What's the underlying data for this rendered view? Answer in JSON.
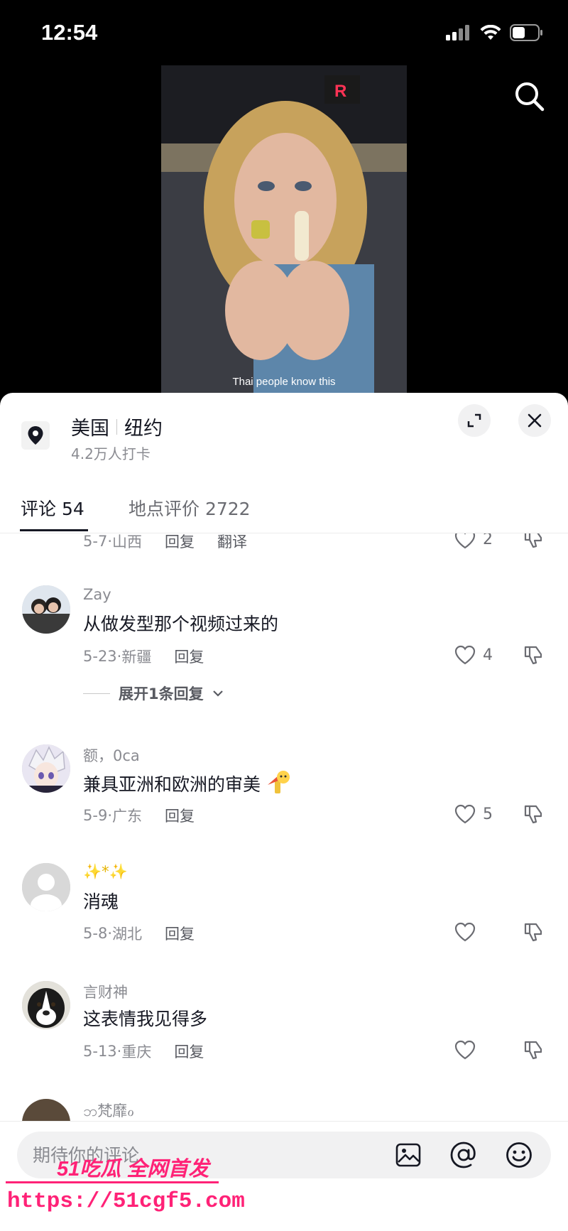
{
  "status_bar": {
    "time": "12:54",
    "icons": [
      "signal-icon",
      "wifi-icon",
      "battery-icon"
    ]
  },
  "video": {
    "caption": "Thai people know this"
  },
  "location": {
    "country": "美国",
    "city": "纽约",
    "checkins": "4.2万人打卡"
  },
  "tabs": [
    {
      "label": "评论 54",
      "active": true
    },
    {
      "label": "地点评价 2722",
      "active": false
    }
  ],
  "comments": [
    {
      "user": "",
      "text": "",
      "date": "5-7",
      "region": "山西",
      "reply": "回复",
      "translate": "翻译",
      "likes": "2",
      "partial": true
    },
    {
      "user": "Zay",
      "text": "从做发型那个视频过来的",
      "date": "5-23",
      "region": "新疆",
      "reply": "回复",
      "likes": "4",
      "expand": "展开1条回复"
    },
    {
      "user": "额，0ca",
      "text": "兼具亚洲和欧洲的审美",
      "date": "5-9",
      "region": "广东",
      "reply": "回复",
      "likes": "5"
    },
    {
      "user": "✨*✨",
      "text": "消魂",
      "date": "5-8",
      "region": "湖北",
      "reply": "回复",
      "likes": ""
    },
    {
      "user": "言财神",
      "text": "这表情我见得多",
      "date": "5-13",
      "region": "重庆",
      "reply": "回复",
      "likes": ""
    },
    {
      "user": "ဘ梵靡ℴ",
      "partial": true
    }
  ],
  "input": {
    "placeholder": "期待你的评论"
  },
  "watermark": {
    "title": "51吃瓜 全网首发",
    "url": "https://51cgf5.com"
  },
  "colors": {
    "accent_text": "#161823",
    "muted": "#8a8b91",
    "watermark": "#ff2277"
  }
}
